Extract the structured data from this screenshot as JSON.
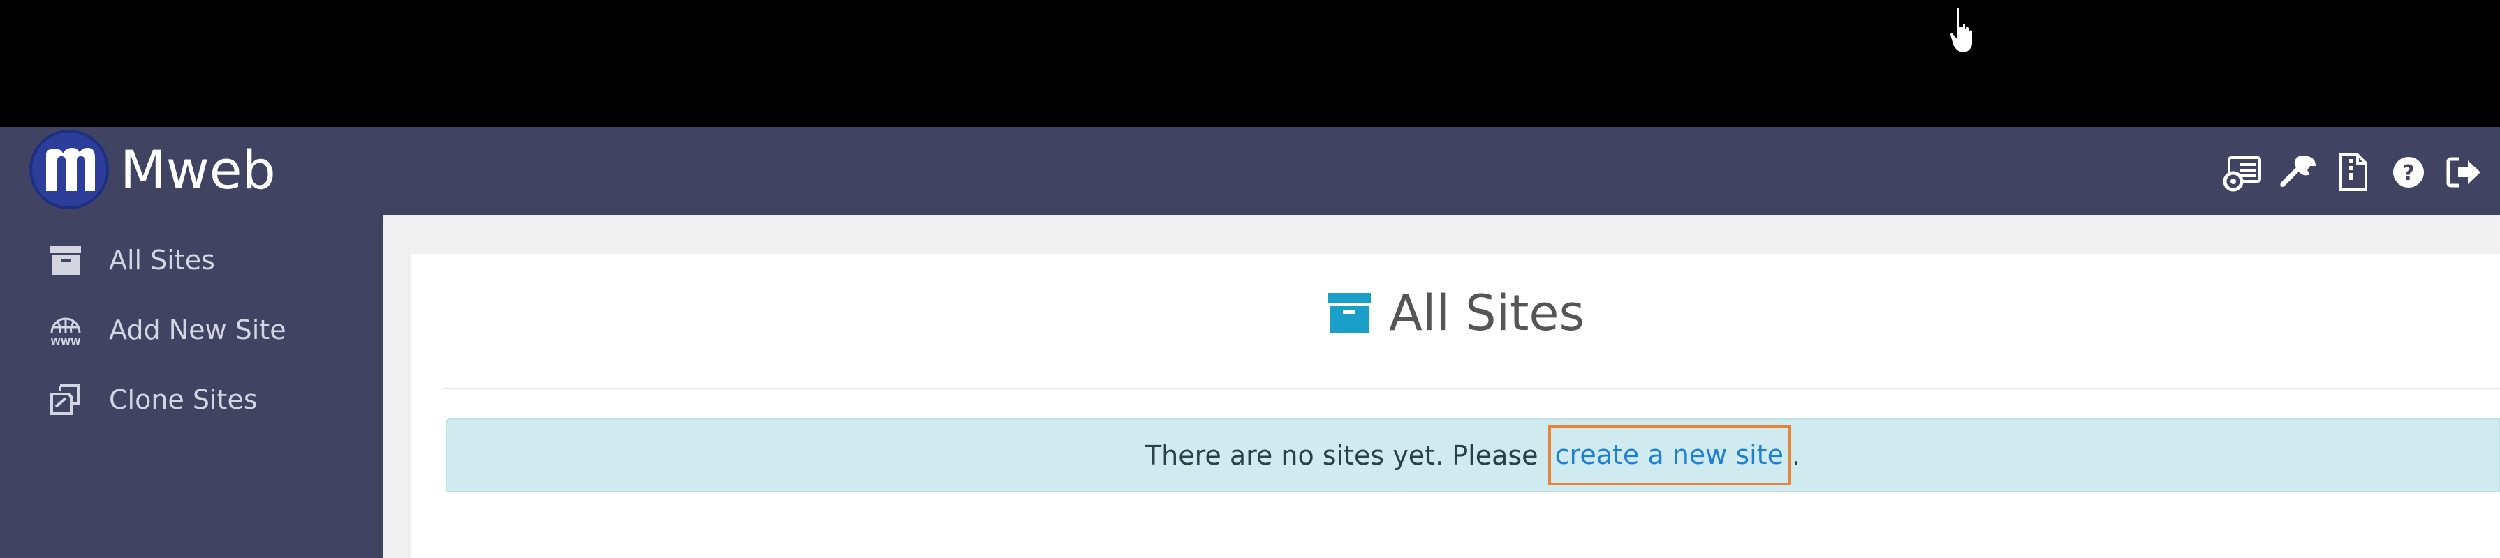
{
  "app": {
    "name": "Mweb",
    "logo_letter": "m"
  },
  "navbar": {
    "icons": [
      "server-settings-icon",
      "wrench-icon",
      "zip-file-icon",
      "help-icon",
      "logout-icon"
    ]
  },
  "sidebar": {
    "items": [
      {
        "label": "All Sites",
        "icon": "archive-icon"
      },
      {
        "label": "Add New Site",
        "icon": "globe-www-icon"
      },
      {
        "label": "Clone Sites",
        "icon": "clone-icon"
      }
    ]
  },
  "main": {
    "title": "All Sites",
    "title_icon": "archive-icon",
    "alert": {
      "text_before": "There are no sites yet. Please ",
      "link_text": "create a new site",
      "text_after": "."
    }
  },
  "colors": {
    "navbar": "#404362",
    "accent": "#1aa0c8",
    "link": "#1f7fd6",
    "alert_bg": "#d0ebef",
    "highlight": "#e8833a"
  }
}
